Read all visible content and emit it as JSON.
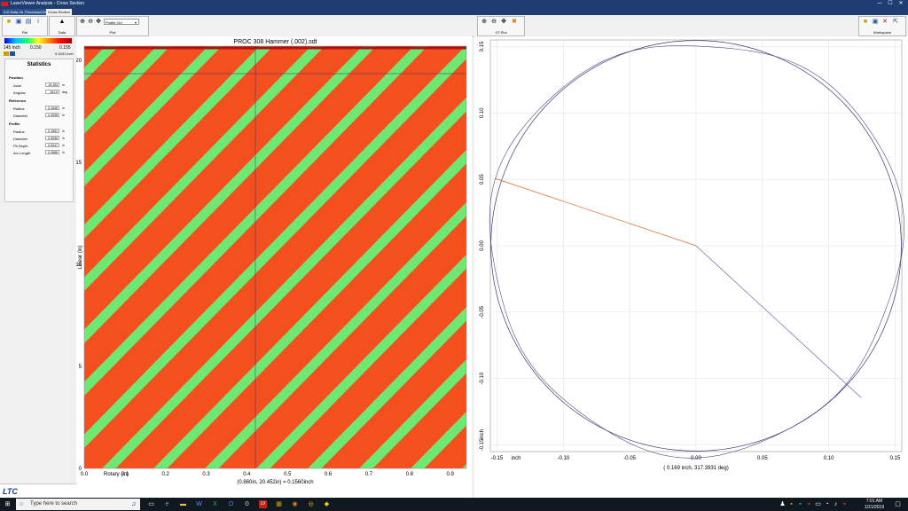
{
  "window": {
    "title": "LaserViewer Analysis - Cross Section",
    "minimize": "—",
    "maximize": "☐",
    "close": "✕"
  },
  "tabs": [
    "3-D Data View",
    "Processed Data",
    "Cross Section"
  ],
  "ribbon": {
    "file_label": "File",
    "data_label": "Data",
    "plot_label": "Plot",
    "profile_select": "Profile Ctrl",
    "xtplot_label": "XT-Plot",
    "workspace_label": "Workspace"
  },
  "colorbar": {
    "min": "145 inch",
    "mid": "0.150",
    "max": "0.155",
    "current": "0.1531 inch"
  },
  "stats": {
    "title": "Statistics",
    "position": {
      "label": "Position",
      "axial_label": "Axial",
      "axial_value": "19.153",
      "axial_unit": "in",
      "angular_label": "Angular",
      "angular_value": "161.5",
      "angular_unit": "deg"
    },
    "reference": {
      "label": "Reference",
      "radius_label": "Radius",
      "radius_value": "0.1546",
      "radius_unit": "in",
      "diameter_label": "Diameter",
      "diameter_value": "0.3098",
      "diameter_unit": "in"
    },
    "profile": {
      "label": "Profile",
      "radius_label": "Radius",
      "radius_value": "0.1551",
      "radius_unit": "in",
      "diameter_label": "Diameter",
      "diameter_value": "0.3056",
      "diameter_unit": "in",
      "pit_label": "Pit Depth",
      "pit_value": "0.0047",
      "pit_unit": "in",
      "arc_label": "Arc Length",
      "arc_value": "0.2686",
      "arc_unit": "in"
    }
  },
  "heatmap": {
    "title": "PROC 308 Hammer (.002).sdt",
    "ylabel": "Linear (in)",
    "xlabel": "Rotary (in)",
    "yticks": [
      "0",
      "5",
      "10",
      "15",
      "20"
    ],
    "xticks": [
      "0.0",
      "0.1",
      "0.2",
      "0.3",
      "0.4",
      "0.5",
      "0.6",
      "0.7",
      "0.8",
      "0.9"
    ],
    "readout": "(0.860in, 20.452in) = 0.1560inch",
    "bg_color": "#f4501e",
    "band_color": "#6ee873"
  },
  "chart_data": {
    "type": "line",
    "title": "",
    "xlabel": "inch",
    "ylabel": "inch",
    "xlim": [
      -0.155,
      0.155
    ],
    "ylim": [
      -0.155,
      0.155
    ],
    "xticks": [
      "-0.15",
      "-0.10",
      "-0.05",
      "0.00",
      "0.05",
      "0.10",
      "0.15"
    ],
    "yticks": [
      "0.15",
      "0.10",
      "0.05",
      "0.00",
      "-0.05",
      "-0.10",
      "-0.15"
    ],
    "grid": true,
    "reference_radius": 0.1546,
    "profile_radius": 0.1551,
    "cursor_angle_deg": 317.3931,
    "cursor_radius": 0.169,
    "marker_angle_deg": 161.5,
    "readout": "( 0.169 inch, 317.3931 deg)"
  },
  "taskbar": {
    "search_placeholder": "Type here to search",
    "time": "7:01 AM",
    "date": "1/21/2019"
  }
}
